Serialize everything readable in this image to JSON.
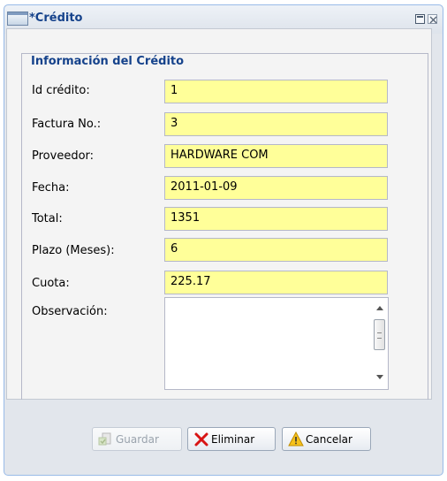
{
  "window": {
    "title": "*Crédito"
  },
  "form": {
    "group_title": "Información del Crédito",
    "fields": [
      {
        "label": "Id crédito:",
        "value": "1"
      },
      {
        "label": "Factura No.:",
        "value": "3"
      },
      {
        "label": "Proveedor:",
        "value": "HARDWARE COM"
      },
      {
        "label": "Fecha:",
        "value": "2011-01-09"
      },
      {
        "label": "Total:",
        "value": "1351"
      },
      {
        "label": "Plazo (Meses):",
        "value": "6"
      },
      {
        "label": "Cuota:",
        "value": "225.17"
      }
    ],
    "observacion": {
      "label": "Observación:",
      "value": ""
    }
  },
  "buttons": {
    "guardar": "Guardar",
    "eliminar": "Eliminar",
    "cancelar": "Cancelar"
  },
  "colors": {
    "field_background": "#ffff99",
    "title_text": "#15428b"
  },
  "icons": {
    "window": "window-icon",
    "maximize": "maximize-icon",
    "close": "close-icon",
    "save": "save-icon",
    "delete": "delete-x-icon",
    "cancel": "warning-icon"
  }
}
